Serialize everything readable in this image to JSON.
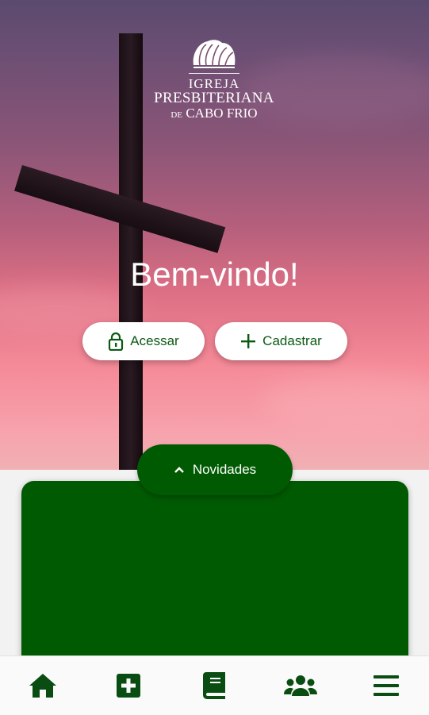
{
  "logo": {
    "line1": "IGREJA",
    "line2": "PRESBITERIANA",
    "line3_prefix": "DE",
    "line3": "CABO FRIO"
  },
  "hero": {
    "welcome": "Bem-vindo!",
    "buttons": {
      "login": {
        "label": "Acessar",
        "icon": "lock-icon"
      },
      "signup": {
        "label": "Cadastrar",
        "icon": "plus-icon"
      }
    }
  },
  "news": {
    "label": "Novidades",
    "icon": "chevron-up-icon"
  },
  "bottom_nav": {
    "items": [
      {
        "icon": "home-icon"
      },
      {
        "icon": "medical-plus-icon"
      },
      {
        "icon": "book-icon"
      },
      {
        "icon": "users-icon"
      },
      {
        "icon": "menu-icon"
      }
    ]
  },
  "colors": {
    "brand_green": "#005a02",
    "button_text": "#0c5a14",
    "nav_icon": "#0a4d12"
  }
}
